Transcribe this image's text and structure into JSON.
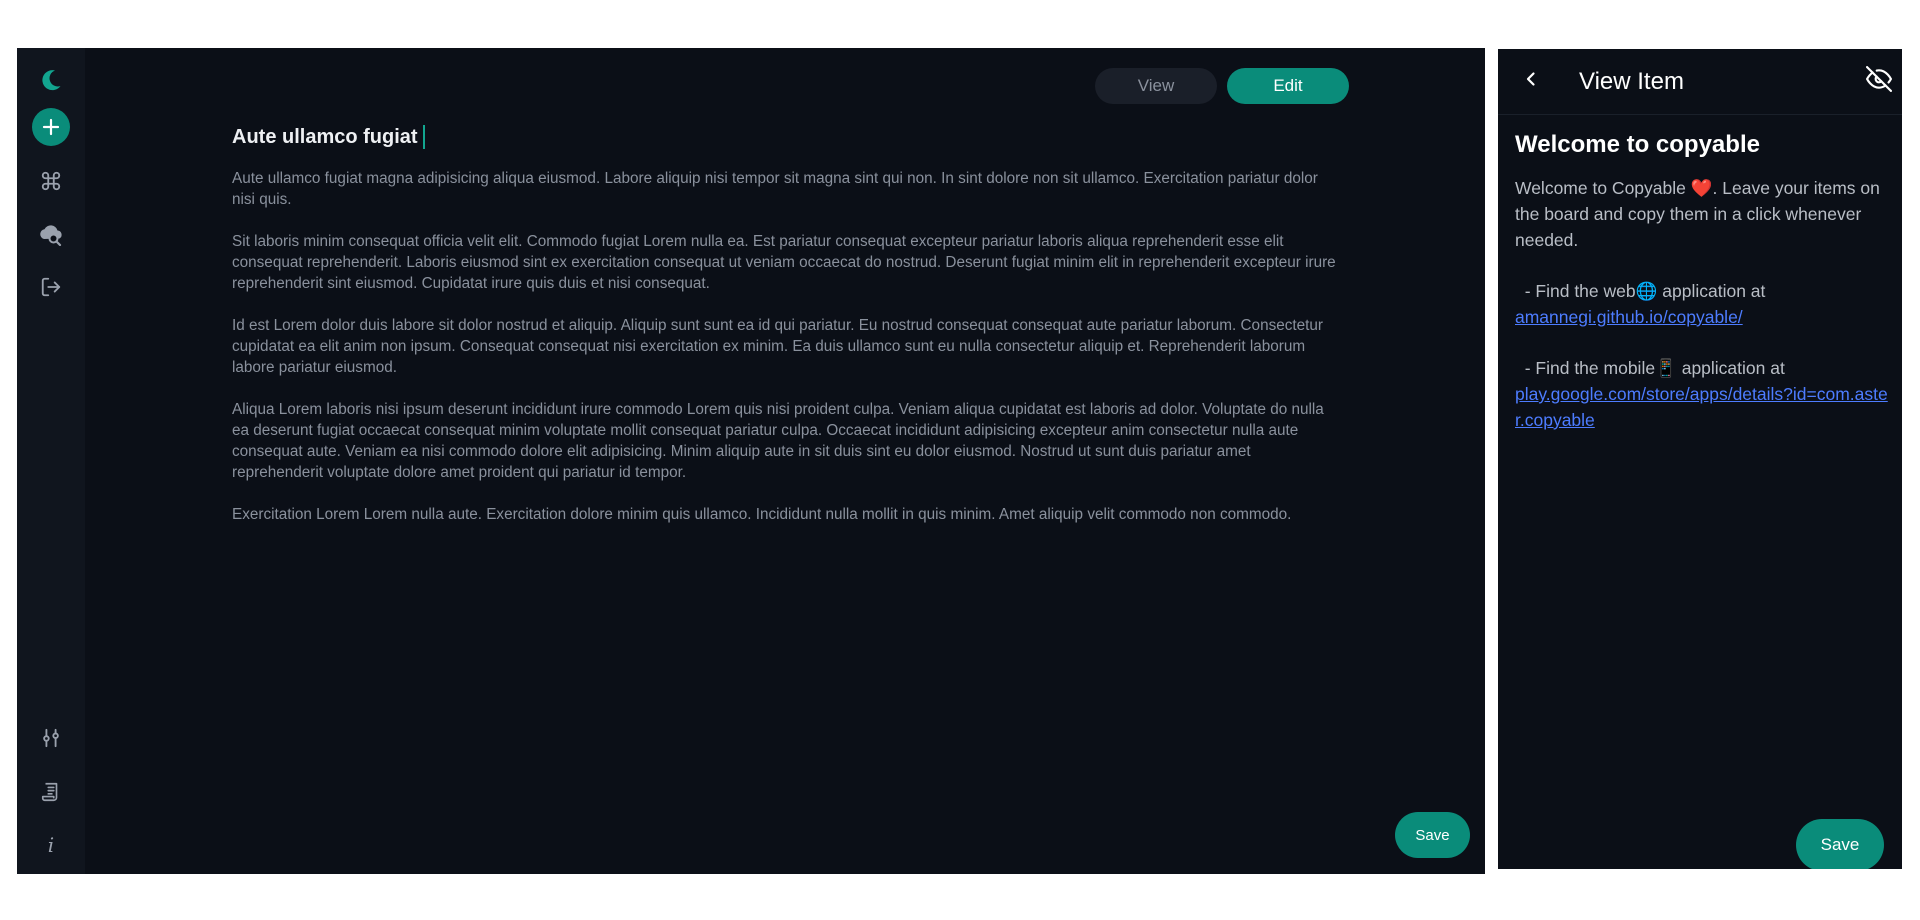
{
  "colors": {
    "accent": "#0a8c7a",
    "background": "#0b0f17",
    "sidebar": "#10151e",
    "link": "#4d7cff"
  },
  "sidebar": {
    "top_items": [
      {
        "name": "moon-icon",
        "label": "Theme"
      },
      {
        "name": "add-icon",
        "label": "Add item"
      },
      {
        "name": "command-icon",
        "label": "Commands"
      },
      {
        "name": "cloud-search-icon",
        "label": "Cloud search"
      },
      {
        "name": "logout-icon",
        "label": "Logout"
      }
    ],
    "bottom_items": [
      {
        "name": "settings-sliders-icon",
        "label": "Settings"
      },
      {
        "name": "document-icon",
        "label": "Changelog"
      },
      {
        "name": "info-icon",
        "label": "Info"
      }
    ],
    "info_glyph": "i"
  },
  "editor": {
    "mode_view_label": "View",
    "mode_edit_label": "Edit",
    "active_mode": "Edit",
    "title": "Aute ullamco fugiat",
    "paragraphs": [
      "Aute ullamco fugiat magna adipisicing aliqua eiusmod. Labore aliquip nisi tempor sit magna sint qui non. In sint dolore non sit ullamco. Exercitation pariatur dolor nisi quis.",
      "Sit laboris minim consequat officia velit elit. Commodo fugiat Lorem nulla ea. Est pariatur consequat excepteur pariatur laboris aliqua reprehenderit esse elit consequat reprehenderit. Laboris eiusmod sint ex exercitation consequat ut veniam occaecat do nostrud. Deserunt fugiat minim elit in reprehenderit excepteur irure reprehenderit sint eiusmod. Cupidatat irure quis duis et nisi consequat.",
      "Id est Lorem dolor duis labore sit dolor nostrud et aliquip. Aliquip sunt sunt ea id qui pariatur. Eu nostrud consequat consequat aute pariatur laborum. Consectetur cupidatat ea elit anim non ipsum. Consequat consequat nisi exercitation ex minim. Ea duis ullamco sunt eu nulla consectetur aliquip et. Reprehenderit laborum labore pariatur eiusmod.",
      "Aliqua Lorem laboris nisi ipsum deserunt incididunt irure commodo Lorem quis nisi proident culpa. Veniam aliqua cupidatat est laboris ad dolor. Voluptate do nulla ea deserunt fugiat occaecat consequat minim voluptate mollit consequat pariatur culpa. Occaecat incididunt adipisicing excepteur anim consectetur nulla aute consequat aute. Veniam ea nisi commodo dolore elit adipisicing. Minim aliquip aute in sit duis sint eu dolor eiusmod. Nostrud ut sunt duis pariatur amet reprehenderit voluptate dolore amet proident qui pariatur id tempor.",
      "Exercitation Lorem Lorem nulla aute. Exercitation dolore minim quis ullamco. Incididunt nulla mollit in quis minim. Amet aliquip velit commodo non commodo."
    ],
    "save_label": "Save"
  },
  "panel": {
    "title": "View Item",
    "content_heading": "Welcome to copyable",
    "intro_before": "Welcome to Copyable ",
    "heart": "❤️",
    "intro_after": ". Leave your items on the board and copy them in a click whenever needed.",
    "web_line": "  - Find the web🌐 application at",
    "web_link": "amannegi.github.io/copyable/",
    "mobile_line": "  - Find the mobile📱 application at",
    "mobile_link": "play.google.com/store/apps/details?id=com.aster.copyable",
    "save_label": "Save"
  }
}
